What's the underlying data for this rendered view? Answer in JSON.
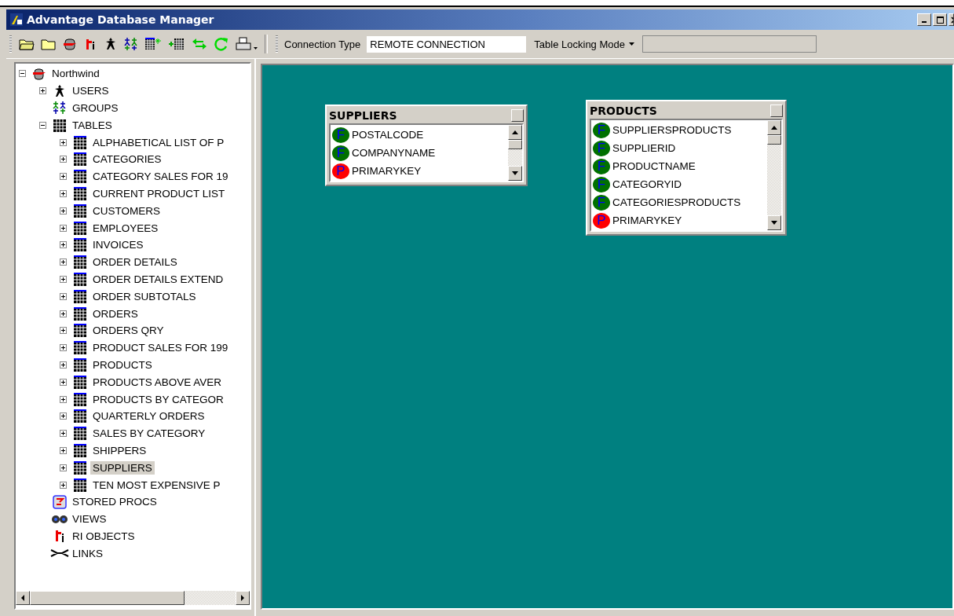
{
  "window": {
    "title": "Advantage Database Manager"
  },
  "toolbar": {
    "connection_label": "Connection Type",
    "connection_value": "REMOTE CONNECTION",
    "locking_label": "Table Locking Mode"
  },
  "tree": [
    {
      "label": "Northwind",
      "kind": "database",
      "expanded": true,
      "selected": false,
      "children": [
        {
          "label": "USERS",
          "kind": "user",
          "expanded": false,
          "selected": false
        },
        {
          "label": "GROUPS",
          "kind": "group",
          "selected": false
        },
        {
          "label": "TABLES",
          "kind": "tables",
          "expanded": true,
          "selected": false,
          "children": [
            {
              "label": "ALPHABETICAL LIST OF P",
              "kind": "table",
              "expanded": false,
              "selected": false
            },
            {
              "label": "CATEGORIES",
              "kind": "table",
              "expanded": false,
              "selected": false
            },
            {
              "label": "CATEGORY SALES FOR 19",
              "kind": "table",
              "expanded": false,
              "selected": false
            },
            {
              "label": "CURRENT PRODUCT LIST",
              "kind": "table",
              "expanded": false,
              "selected": false
            },
            {
              "label": "CUSTOMERS",
              "kind": "table",
              "expanded": false,
              "selected": false
            },
            {
              "label": "EMPLOYEES",
              "kind": "table",
              "expanded": false,
              "selected": false
            },
            {
              "label": "INVOICES",
              "kind": "table",
              "expanded": false,
              "selected": false
            },
            {
              "label": "ORDER DETAILS",
              "kind": "table",
              "expanded": false,
              "selected": false
            },
            {
              "label": "ORDER DETAILS EXTEND",
              "kind": "table",
              "expanded": false,
              "selected": false
            },
            {
              "label": "ORDER SUBTOTALS",
              "kind": "table",
              "expanded": false,
              "selected": false
            },
            {
              "label": "ORDERS",
              "kind": "table",
              "expanded": false,
              "selected": false
            },
            {
              "label": "ORDERS QRY",
              "kind": "table",
              "expanded": false,
              "selected": false
            },
            {
              "label": "PRODUCT SALES FOR 199",
              "kind": "table",
              "expanded": false,
              "selected": false
            },
            {
              "label": "PRODUCTS",
              "kind": "table",
              "expanded": false,
              "selected": false
            },
            {
              "label": "PRODUCTS ABOVE AVER",
              "kind": "table",
              "expanded": false,
              "selected": false
            },
            {
              "label": "PRODUCTS BY CATEGOR",
              "kind": "table",
              "expanded": false,
              "selected": false
            },
            {
              "label": "QUARTERLY ORDERS",
              "kind": "table",
              "expanded": false,
              "selected": false
            },
            {
              "label": "SALES BY CATEGORY",
              "kind": "table",
              "expanded": false,
              "selected": false
            },
            {
              "label": "SHIPPERS",
              "kind": "table",
              "expanded": false,
              "selected": false
            },
            {
              "label": "SUPPLIERS",
              "kind": "table",
              "expanded": false,
              "selected": true
            },
            {
              "label": "TEN MOST EXPENSIVE P",
              "kind": "table",
              "expanded": false,
              "selected": false
            }
          ]
        },
        {
          "label": "STORED PROCS",
          "kind": "procs",
          "selected": false
        },
        {
          "label": "VIEWS",
          "kind": "views",
          "selected": false
        },
        {
          "label": "RI OBJECTS",
          "kind": "ri",
          "selected": false
        },
        {
          "label": "LINKS",
          "kind": "links",
          "selected": false
        }
      ]
    }
  ],
  "canvas": {
    "tables": [
      {
        "title": "SUPPLIERS",
        "fields": [
          {
            "name": "POSTALCODE",
            "kind": "foreign",
            "badge": "F"
          },
          {
            "name": "COMPANYNAME",
            "kind": "foreign",
            "badge": "F"
          },
          {
            "name": "PRIMARYKEY",
            "kind": "primary",
            "badge": "P"
          }
        ]
      },
      {
        "title": "PRODUCTS",
        "fields": [
          {
            "name": "SUPPLIERSPRODUCTS",
            "kind": "foreign",
            "badge": "F"
          },
          {
            "name": "SUPPLIERID",
            "kind": "foreign",
            "badge": "F"
          },
          {
            "name": "PRODUCTNAME",
            "kind": "foreign",
            "badge": "F"
          },
          {
            "name": "CATEGORYID",
            "kind": "foreign",
            "badge": "F"
          },
          {
            "name": "CATEGORIESPRODUCTS",
            "kind": "foreign",
            "badge": "F"
          },
          {
            "name": "PRIMARYKEY",
            "kind": "primary",
            "badge": "P"
          }
        ]
      }
    ]
  }
}
